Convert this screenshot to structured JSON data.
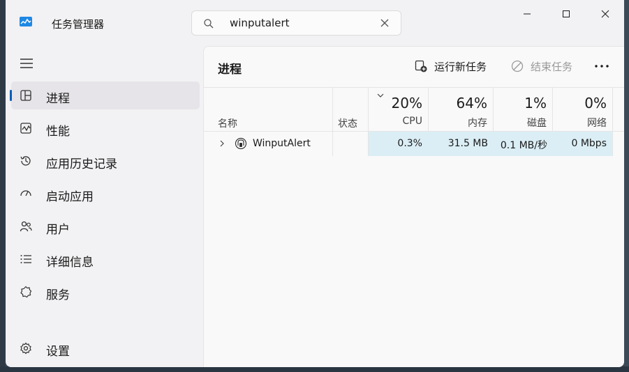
{
  "app": {
    "title": "任务管理器"
  },
  "search": {
    "value": "winputalert"
  },
  "nav": {
    "items": [
      {
        "label": "进程",
        "icon": "processes-icon",
        "active": true
      },
      {
        "label": "性能",
        "icon": "performance-icon"
      },
      {
        "label": "应用历史记录",
        "icon": "app-history-icon"
      },
      {
        "label": "启动应用",
        "icon": "startup-apps-icon"
      },
      {
        "label": "用户",
        "icon": "users-icon"
      },
      {
        "label": "详细信息",
        "icon": "details-icon"
      },
      {
        "label": "服务",
        "icon": "services-icon"
      }
    ],
    "settings_label": "设置"
  },
  "main": {
    "title": "进程",
    "run_new_task_label": "运行新任务",
    "end_task_label": "结束任务"
  },
  "table": {
    "columns": {
      "name": "名称",
      "status": "状态",
      "cpu": {
        "pct": "20%",
        "label": "CPU"
      },
      "memory": {
        "pct": "64%",
        "label": "内存"
      },
      "disk": {
        "pct": "1%",
        "label": "磁盘"
      },
      "network": {
        "pct": "0%",
        "label": "网络"
      }
    },
    "rows": [
      {
        "name": "WinputAlert",
        "status": "",
        "cpu": "0.3%",
        "memory": "31.5 MB",
        "disk": "0.1 MB/秒",
        "network": "0 Mbps"
      }
    ]
  },
  "colors": {
    "accent": "#005fb8",
    "highlight": "#dbeef5"
  }
}
